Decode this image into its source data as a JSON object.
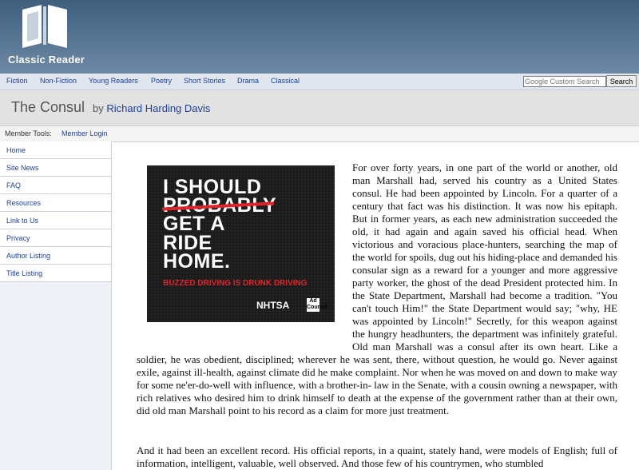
{
  "header": {
    "logo_text": "Classic Reader"
  },
  "nav": [
    "Fiction",
    "Non-Fiction",
    "Young Readers",
    "Poetry",
    "Short Stories",
    "Drama",
    "Classical"
  ],
  "search": {
    "placeholder": "Google Custom Search",
    "button_label": "Search"
  },
  "book": {
    "title": "The Consul",
    "by": "by",
    "author": "Richard Harding Davis"
  },
  "member": {
    "label": "Member Tools:",
    "login": "Member Login"
  },
  "sidebar": [
    "Home",
    "Site News",
    "FAQ",
    "Resources",
    "Link to Us",
    "Privacy",
    "Author Listing",
    "Title Listing"
  ],
  "ad": {
    "line1": "I SHOULD",
    "line2": "PROBABLY",
    "line3": "GET A",
    "line4": "RIDE",
    "line5": "HOME.",
    "tagline": "BUZZED DRIVING IS DRUNK DRIVING",
    "logo": "NHTSA",
    "mark": "Ad Council"
  },
  "text": {
    "p1": "For over forty years, in one part of the world or another, old man Marshall had, served his country as a United States consul. He had been appointed by Lincoln. For a quarter of a century that fact was his distinction. It was now his epitaph. But in former years, as each new administration succeeded the old, it had again and again saved his official head. When victorious and voracious place-hunters, searching the map of the world for spoils, dug out his hiding-place and demanded his consular sign as a reward for a younger and more aggressive party worker, the ghost of the dead President protected him. In the State Department, Marshall had become a tradition. \"You can't touch Him!\" the State Department would say; \"why, HE was appointed by Lincoln!\" Secretly, for this weapon against the hungry headhunters, the department was infinitely grateful. Old man Marshall was a consul after its own heart. Like a soldier, he was obedient, disciplined; wherever he was sent, there, without question, he would go. Never against exile, against ill-health, against climate did he make complaint. Nor when he was moved on and down to make way for some ne'er-do-well with influence, with a brother-in- law in the Senate, with a cousin owning a newspaper, with rich relatives who desired him to drink himself to death at the expense of the government rather than at their own, did old man Marshall point to his record as a claim for more just treatment.",
    "p2": "And it had been an excellent record. His official reports, in a quaint, stately hand, were models of English; full of information, intelligent, valuable, well observed. And those few of his countrymen, who stumbled"
  }
}
